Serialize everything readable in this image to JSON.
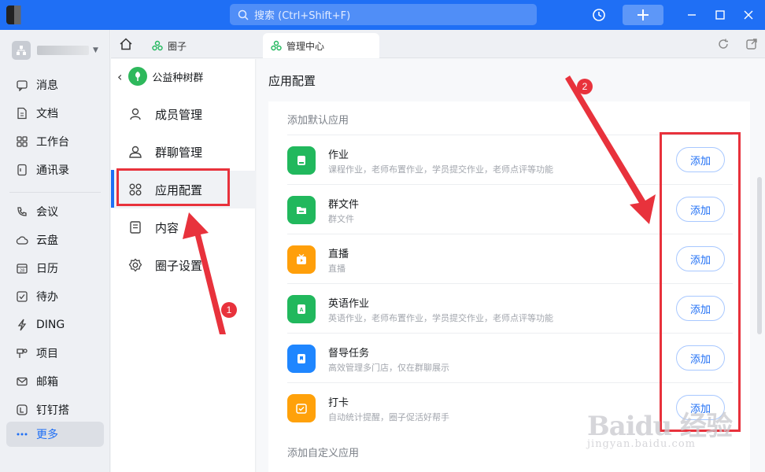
{
  "titlebar": {
    "search_placeholder": "搜索 (Ctrl+Shift+F)",
    "accent_color": "#1f6ff5"
  },
  "leftnav": {
    "items": [
      {
        "label": "消息",
        "icon": "message-icon"
      },
      {
        "label": "文档",
        "icon": "document-icon"
      },
      {
        "label": "工作台",
        "icon": "workbench-icon"
      },
      {
        "label": "通讯录",
        "icon": "contacts-icon"
      },
      {
        "label": "会议",
        "icon": "meeting-icon"
      },
      {
        "label": "云盘",
        "icon": "cloud-icon"
      },
      {
        "label": "日历",
        "icon": "calendar-icon"
      },
      {
        "label": "待办",
        "icon": "todo-icon"
      },
      {
        "label": "DING",
        "icon": "ding-icon"
      },
      {
        "label": "项目",
        "icon": "project-icon"
      },
      {
        "label": "邮箱",
        "icon": "mail-icon"
      },
      {
        "label": "钉钉搭",
        "icon": "builder-icon"
      },
      {
        "label": "更多",
        "icon": "more-icon"
      }
    ],
    "active_item": "更多"
  },
  "tabs": [
    {
      "label": "圈子",
      "active": false
    },
    {
      "label": "管理中心",
      "active": true
    }
  ],
  "subnav": {
    "group_name": "公益种树群",
    "items": [
      {
        "label": "成员管理",
        "icon": "member-icon"
      },
      {
        "label": "群聊管理",
        "icon": "group-chat-icon"
      },
      {
        "label": "应用配置",
        "icon": "app-grid-icon"
      },
      {
        "label": "内容",
        "icon": "content-icon"
      },
      {
        "label": "圈子设置",
        "icon": "settings-icon"
      }
    ],
    "active_item": "应用配置"
  },
  "main": {
    "title": "应用配置",
    "default_section_label": "添加默认应用",
    "custom_section_label": "添加自定义应用",
    "add_label": "添加",
    "apps": [
      {
        "name": "作业",
        "desc": "课程作业，老师布置作业，学员提交作业，老师点评等功能",
        "color": "#21b85d"
      },
      {
        "name": "群文件",
        "desc": "群文件",
        "color": "#21b85d"
      },
      {
        "name": "直播",
        "desc": "直播",
        "color": "#ff9f0a"
      },
      {
        "name": "英语作业",
        "desc": "英语作业，老师布置作业，学员提交作业，老师点评等功能",
        "color": "#21b85d"
      },
      {
        "name": "督导任务",
        "desc": "高效管理多门店，仅在群聊展示",
        "color": "#1f86ff"
      },
      {
        "name": "打卡",
        "desc": "自动统计提醒，圈子促活好帮手",
        "color": "#ffa10a"
      }
    ]
  },
  "annotations": {
    "badge1": "1",
    "badge2": "2",
    "highlight_color": "#e8323c"
  },
  "watermark": {
    "brand": "Baidu 经验",
    "url": "jingyan.baidu.com"
  }
}
